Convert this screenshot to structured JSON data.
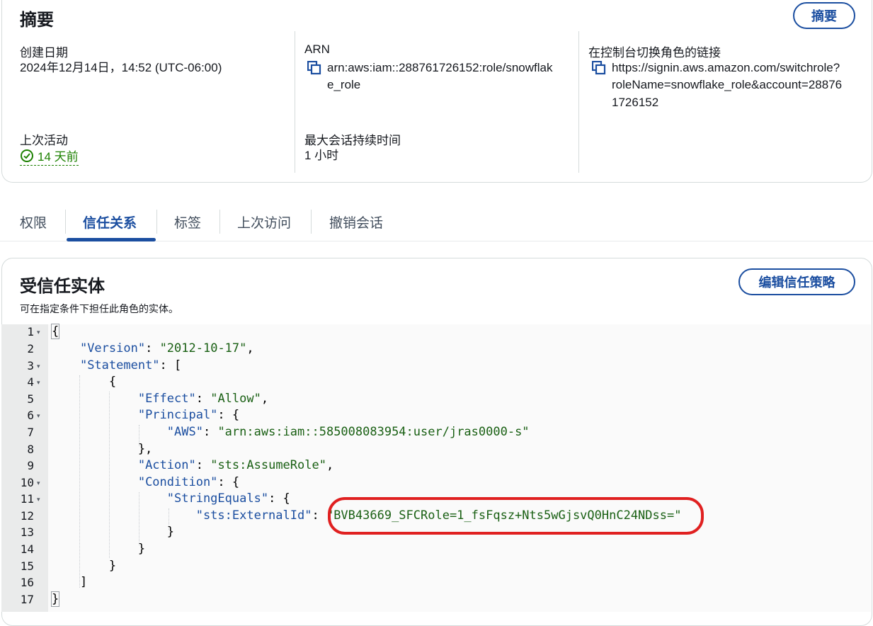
{
  "summary": {
    "title": "摘要",
    "button_label": "摘要",
    "created_label": "创建日期",
    "created_value": "2024年12月14日，14:52 (UTC-06:00)",
    "arn_label": "ARN",
    "arn_line1": "arn:aws:iam::288761726152:role/snowflak",
    "arn_line2": "e_role",
    "switch_label": "在控制台切换角色的链接",
    "switch_line1": "https://signin.aws.amazon.com/switchrole?",
    "switch_line2": "roleName=snowflake_role&account=28876",
    "switch_line3": "1726152",
    "last_activity_label": "上次活动",
    "last_activity_value": "14 天前",
    "max_session_label": "最大会话持续时间",
    "max_session_value": "1 小时"
  },
  "tabs": [
    "权限",
    "信任关系",
    "标签",
    "上次访问",
    "撤销会话"
  ],
  "trust": {
    "title": "受信任实体",
    "description": "可在指定条件下担任此角色的实体。",
    "edit_button": "编辑信任策略"
  },
  "editor": {
    "lines": [
      {
        "n": "1",
        "fold": true
      },
      {
        "n": "2",
        "fold": false
      },
      {
        "n": "3",
        "fold": true
      },
      {
        "n": "4",
        "fold": true
      },
      {
        "n": "5",
        "fold": false
      },
      {
        "n": "6",
        "fold": true
      },
      {
        "n": "7",
        "fold": false
      },
      {
        "n": "8",
        "fold": false
      },
      {
        "n": "9",
        "fold": false
      },
      {
        "n": "10",
        "fold": true
      },
      {
        "n": "11",
        "fold": true
      },
      {
        "n": "12",
        "fold": false
      },
      {
        "n": "13",
        "fold": false
      },
      {
        "n": "14",
        "fold": false
      },
      {
        "n": "15",
        "fold": false
      },
      {
        "n": "16",
        "fold": false
      },
      {
        "n": "17",
        "fold": false
      }
    ],
    "code": {
      "version_key": "\"Version\"",
      "version_val": "\"2012-10-17\"",
      "statement_key": "\"Statement\"",
      "effect_key": "\"Effect\"",
      "effect_val": "\"Allow\"",
      "principal_key": "\"Principal\"",
      "aws_key": "\"AWS\"",
      "aws_val": "\"arn:aws:iam::585008083954:user/jras0000-s\"",
      "action_key": "\"Action\"",
      "action_val": "\"sts:AssumeRole\"",
      "condition_key": "\"Condition\"",
      "stringequals_key": "\"StringEquals\"",
      "externalid_key": "\"sts:ExternalId\"",
      "externalid_val": "\"BVB43669_SFCRole=1_fsFqsz+Nts5wGjsvQ0HnC24NDss=\""
    }
  },
  "colors": {
    "accent": "#1b4ea0",
    "success": "#1d8102",
    "highlight": "#e02020"
  }
}
